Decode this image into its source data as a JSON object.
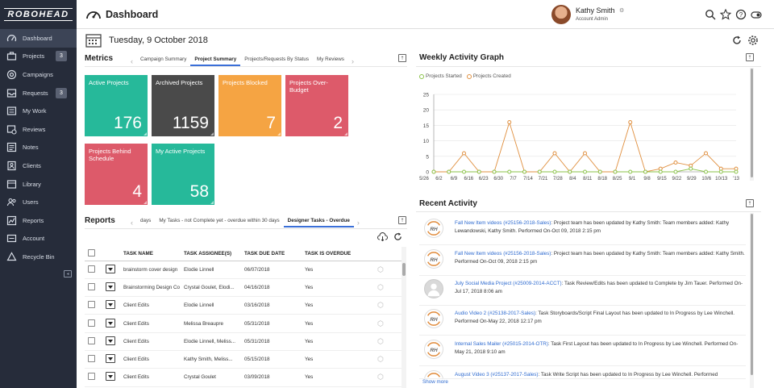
{
  "brand": "ROBOHEAD",
  "sidebar": {
    "items": [
      {
        "label": "Dashboard",
        "icon": "dashboard-icon",
        "active": true
      },
      {
        "label": "Projects",
        "icon": "briefcase-icon",
        "count": "3"
      },
      {
        "label": "Campaigns",
        "icon": "campaign-icon"
      },
      {
        "label": "Requests",
        "icon": "inbox-icon",
        "count": "3"
      },
      {
        "label": "My Work",
        "icon": "mywork-icon"
      },
      {
        "label": "Reviews",
        "icon": "review-icon"
      },
      {
        "label": "Notes",
        "icon": "note-icon"
      },
      {
        "label": "Clients",
        "icon": "client-icon"
      },
      {
        "label": "Library",
        "icon": "library-icon"
      },
      {
        "label": "Users",
        "icon": "users-icon"
      },
      {
        "label": "Reports",
        "icon": "chart-icon"
      },
      {
        "label": "Account",
        "icon": "account-icon"
      },
      {
        "label": "Recycle Bin",
        "icon": "recycle-icon"
      }
    ]
  },
  "header": {
    "title": "Dashboard",
    "user_name": "Kathy Smith",
    "user_role": "Account Admin"
  },
  "date": "Tuesday, 9 October 2018",
  "metrics": {
    "title": "Metrics",
    "tabs": [
      "Campaign Summary",
      "Project Summary",
      "Projects/Requests By Status",
      "My Reviews"
    ],
    "active_tab": 1,
    "tiles": [
      {
        "label": "Active Projects",
        "value": "176",
        "color": "#26b99a"
      },
      {
        "label": "Archived Projects",
        "value": "1159",
        "color": "#4a4a4a"
      },
      {
        "label": "Projects Blocked",
        "value": "7",
        "color": "#f5a443"
      },
      {
        "label": "Projects Over-Budget",
        "value": "2",
        "color": "#dd5a6a"
      },
      {
        "label": "Projects Behind Schedule",
        "value": "4",
        "color": "#dd5a6a"
      },
      {
        "label": "My Active Projects",
        "value": "58",
        "color": "#26b99a"
      }
    ]
  },
  "reports": {
    "title": "Reports",
    "tabs": [
      "days",
      "My Tasks - not Complete yet - overdue within 30 days",
      "Designer Tasks - Overdue"
    ],
    "active_tab": 2,
    "columns": [
      "TASK NAME",
      "TASK ASSIGNEE(S)",
      "TASK DUE DATE",
      "TASK IS OVERDUE"
    ],
    "rows": [
      [
        "brainstorm cover design",
        "Elodie Linnell",
        "06/07/2018",
        "Yes"
      ],
      [
        "Brainstorming Design Co",
        "Crystal Goulet, Elodi...",
        "04/16/2018",
        "Yes"
      ],
      [
        "Client Edits",
        "Elodie Linnell",
        "03/16/2018",
        "Yes"
      ],
      [
        "Client Edits",
        "Melissa Breaupre",
        "05/31/2018",
        "Yes"
      ],
      [
        "Client Edits",
        "Elodie Linnell, Meliss...",
        "05/31/2018",
        "Yes"
      ],
      [
        "Client Edits",
        "Kathy Smith, Meliss...",
        "05/15/2018",
        "Yes"
      ],
      [
        "Client Edits",
        "Crystal Goulet",
        "03/09/2018",
        "Yes"
      ]
    ]
  },
  "weekly": {
    "title": "Weekly Activity Graph"
  },
  "chart_data": {
    "type": "line",
    "x": [
      "5/26",
      "6/2",
      "6/9",
      "6/16",
      "6/23",
      "6/30",
      "7/7",
      "7/14",
      "7/21",
      "7/28",
      "8/4",
      "8/11",
      "8/18",
      "8/25",
      "9/1",
      "9/8",
      "9/15",
      "9/22",
      "9/29",
      "10/6",
      "10/13",
      "'13"
    ],
    "series": [
      {
        "name": "Projects Started",
        "color": "#8bc34a",
        "values": [
          0,
          0,
          0,
          0,
          0,
          0,
          0,
          0,
          0,
          0,
          0,
          0,
          0,
          0,
          0,
          0,
          0,
          1,
          0,
          0,
          0
        ]
      },
      {
        "name": "Projects Created",
        "color": "#e09040",
        "values": [
          0,
          0,
          6,
          0,
          0,
          16,
          0,
          0,
          6,
          0,
          6,
          0,
          0,
          16,
          0,
          1,
          3,
          2,
          6,
          1,
          1
        ]
      }
    ],
    "ylim": [
      0,
      25
    ],
    "yticks": [
      "0",
      "5",
      "10",
      "15",
      "20",
      "25"
    ],
    "legend": "top-left"
  },
  "recent": {
    "title": "Recent Activity",
    "show_more": "Show more",
    "items": [
      {
        "icon": "robohead-logo-icon",
        "link": "Fall New Item videos (#25156-2018-Sales)",
        "text": ": Project team has been updated by Kathy Smith: Team members added: Kathy Lewandowski, Kathy Smith.  Performed On-Oct 09, 2018 2:15 pm"
      },
      {
        "icon": "robohead-logo-icon",
        "link": "Fall New Item videos (#25156-2018-Sales)",
        "text": ": Project team has been updated by Kathy Smith: Team members added: Kathy Smith.  Performed On-Oct 09, 2018 2:15 pm"
      },
      {
        "icon": "person-icon",
        "link": "July Social Media Project (#25009-2014-ACCT)",
        "text": ": Task Review/Edits has been updated to Complete by Jim Tauer.  Performed On-Jul 17, 2018 8:06 am"
      },
      {
        "icon": "robohead-logo-icon",
        "link": "Audio Video 2 (#25138-2017-Sales)",
        "text": ": Task Storyboards/Script Final Layout has been updated to In Progress by Lee Winchell.  Performed On-May 22, 2018 12:17 pm"
      },
      {
        "icon": "robohead-logo-icon",
        "link": "Internal Sales Mailer (#25015-2014-OTR)",
        "text": ": Task First Layout has been updated to In Progress by Lee Winchell.  Performed On-May 21, 2018 9:10 am"
      },
      {
        "icon": "robohead-logo-icon",
        "link": "August Video 3 (#25137-2017-Sales)",
        "text": ": Task Write Script has been updated to In Progress by Lee Winchell. Performed"
      }
    ]
  }
}
